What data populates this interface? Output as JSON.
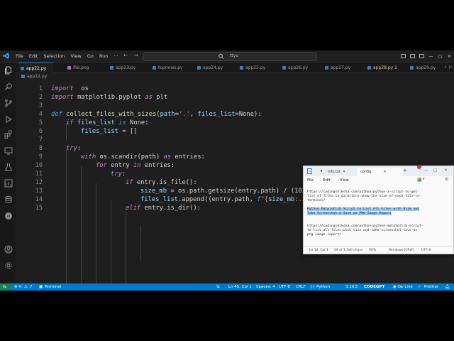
{
  "menu": [
    "File",
    "Edit",
    "Selection",
    "View",
    "Go",
    "Run",
    "···"
  ],
  "search": {
    "value": "ttyu"
  },
  "tabs": [
    {
      "label": "app22.py",
      "style": "active"
    },
    {
      "label": "file.png",
      "style": "italic"
    },
    {
      "label": "app23.py",
      "style": ""
    },
    {
      "label": "topnews.py",
      "style": ""
    },
    {
      "label": "app24.py",
      "style": ""
    },
    {
      "label": "app25.py",
      "style": ""
    },
    {
      "label": "app26.py",
      "style": ""
    },
    {
      "label": "app27.py",
      "style": ""
    },
    {
      "label": "app28.py 1",
      "style": "mod"
    },
    {
      "label": "app29.py",
      "style": ""
    }
  ],
  "breadcrumb": "app22.py",
  "line_numbers": [
    "1",
    "2",
    "3",
    "4",
    "5",
    "6",
    "7",
    "8",
    "9",
    "10",
    "11",
    "12",
    "13",
    "14",
    "15"
  ],
  "code_lines": [
    [
      [
        "kw",
        "import"
      ],
      [
        "",
        "  os"
      ]
    ],
    [
      [
        "kw",
        "import"
      ],
      [
        "",
        " matplotlib.pyplot "
      ],
      [
        "kw",
        "as"
      ],
      [
        "",
        " plt"
      ]
    ],
    [],
    [
      [
        "kd",
        "def"
      ],
      [
        "",
        " "
      ],
      [
        "fn",
        "collect_files_with_sizes"
      ],
      [
        "",
        "("
      ],
      [
        "var",
        "path"
      ],
      [
        "",
        "="
      ],
      [
        "str",
        "'.'"
      ],
      [
        "",
        ", "
      ],
      [
        "var",
        "files_list"
      ],
      [
        "",
        "=None):"
      ]
    ],
    [
      [
        "kw",
        "if"
      ],
      [
        "",
        " "
      ],
      [
        "var",
        "files_list"
      ],
      [
        "",
        " "
      ],
      [
        "kd",
        "is"
      ],
      [
        "",
        " None:"
      ]
    ],
    [
      [
        "var",
        "files_list"
      ],
      [
        "",
        " = []"
      ]
    ],
    [],
    [
      [
        "kw",
        "try"
      ],
      [
        "",
        ":"
      ]
    ],
    [
      [
        "kw",
        "with"
      ],
      [
        "",
        " os.scandir(path) "
      ],
      [
        "kw",
        "as"
      ],
      [
        "",
        " entries:"
      ]
    ],
    [
      [
        "kw",
        "for"
      ],
      [
        "",
        " entry "
      ],
      [
        "kw",
        "in"
      ],
      [
        "",
        " entries:"
      ]
    ],
    [
      [
        "kw",
        "try"
      ],
      [
        "",
        ":"
      ]
    ],
    [
      [
        "kw",
        "if"
      ],
      [
        "",
        " entry.is_file():"
      ]
    ],
    [
      [
        "var",
        "size_mb"
      ],
      [
        "",
        " = os.path.getsize(entry.path) / (102"
      ]
    ],
    [
      [
        "var",
        "files_list"
      ],
      [
        "",
        ".append((entry.path, "
      ],
      [
        "kd",
        "f"
      ],
      [
        "str",
        "\"{"
      ],
      [
        "var",
        "size_mb"
      ],
      [
        "str",
        ":.2f} MB\""
      ],
      [
        "",
        "))"
      ]
    ],
    [
      [
        "kw",
        "elif"
      ],
      [
        "",
        " entry.is_dir():"
      ]
    ]
  ],
  "status": {
    "errors": "0",
    "warnings": "7",
    "terminal": "Terminal",
    "position": "Ln 45, Col 1",
    "spaces": "Spaces: 4",
    "encoding": "UTF-8",
    "eol": "CRLF",
    "language": "Python",
    "version": "3.10.5",
    "codegpt": "CODEGPT",
    "golive": "Go Live",
    "prettier": "Prettier"
  },
  "notepad": {
    "tabs": [
      "info.txt",
      "config"
    ],
    "menu": [
      "File",
      "Edit",
      "View"
    ],
    "text_lines": [
      "https://codingshiksha.com/python/python-3-script-to-get-",
      "list-of-files-in-directory-show-the-size-of-each-file-in-",
      "terminal/",
      "",
      "Python Matplotlib Script to List All Files with Size and",
      "Take Screenshot & Save as PNG Image Report",
      "",
      "",
      "https://codingshiksha.com/python/python-matplotlib-script-",
      "to-list-all-files-with-size-and-take-screenshot-save-as-",
      "png-image-report/"
    ],
    "selected_lines": [
      4,
      5
    ],
    "status": [
      "Ln 14, Col 1",
      "59 of 1,389 chara",
      "90%",
      "Windows (CRLF)",
      "UTF-8"
    ]
  }
}
